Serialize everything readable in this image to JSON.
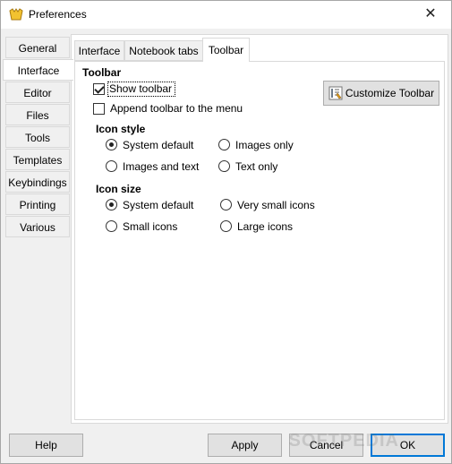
{
  "window": {
    "title": "Preferences",
    "close_glyph": "✕"
  },
  "side_tabs": [
    "General",
    "Interface",
    "Editor",
    "Files",
    "Tools",
    "Templates",
    "Keybindings",
    "Printing",
    "Various"
  ],
  "top_tabs": [
    "Interface",
    "Notebook tabs",
    "Toolbar"
  ],
  "toolbar_section": {
    "heading": "Toolbar",
    "show_toolbar": "Show toolbar",
    "append_toolbar": "Append toolbar to the menu",
    "customize_button": "Customize Toolbar"
  },
  "icon_style": {
    "heading": "Icon style",
    "system_default": "System default",
    "images_only": "Images only",
    "images_and_text": "Images and text",
    "text_only": "Text only"
  },
  "icon_size": {
    "heading": "Icon size",
    "system_default": "System default",
    "very_small": "Very small icons",
    "small": "Small icons",
    "large": "Large icons"
  },
  "buttons": {
    "help": "Help",
    "apply": "Apply",
    "cancel": "Cancel",
    "ok": "OK"
  },
  "watermark": "SOFTPEDIA",
  "colors": {
    "accent": "#0078d7",
    "window_bg": "#f0f0f0"
  }
}
